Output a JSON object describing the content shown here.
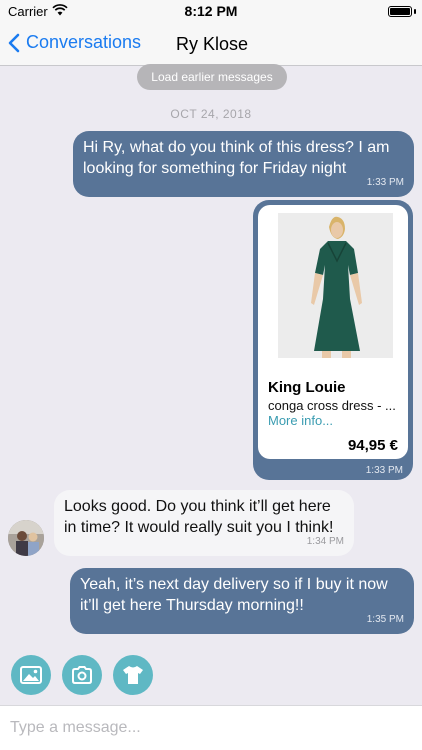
{
  "status": {
    "carrier": "Carrier",
    "time": "8:12 PM"
  },
  "nav": {
    "back_label": "Conversations",
    "title": "Ry Klose"
  },
  "load_earlier": "Load earlier messages",
  "date": "OCT 24, 2018",
  "messages": [
    {
      "direction": "out",
      "text": "Hi Ry, what do you think of this dress? I am looking for something for Friday night",
      "time": "1:33 PM"
    },
    {
      "direction": "in",
      "text": "Looks good. Do you think it’ll get here in time? It would really suit you I think!",
      "time": "1:34 PM"
    },
    {
      "direction": "out",
      "text": "Yeah, it’s next day delivery so if I buy it now it’ll get here Thursday morning!!",
      "time": "1:35 PM"
    }
  ],
  "product": {
    "brand": "King Louie",
    "name": "conga cross dress - ...",
    "more": "More info...",
    "price": "94,95 €",
    "time": "1:33 PM"
  },
  "attachments": [
    {
      "icon": "image-icon"
    },
    {
      "icon": "camera-icon"
    },
    {
      "icon": "tshirt-icon"
    }
  ],
  "composer": {
    "placeholder": "Type a message..."
  },
  "colors": {
    "outgoing_bubble": "#587497",
    "incoming_bubble": "#f5f5f7",
    "accent": "#5fb8c4",
    "link": "#1a7bf0"
  }
}
